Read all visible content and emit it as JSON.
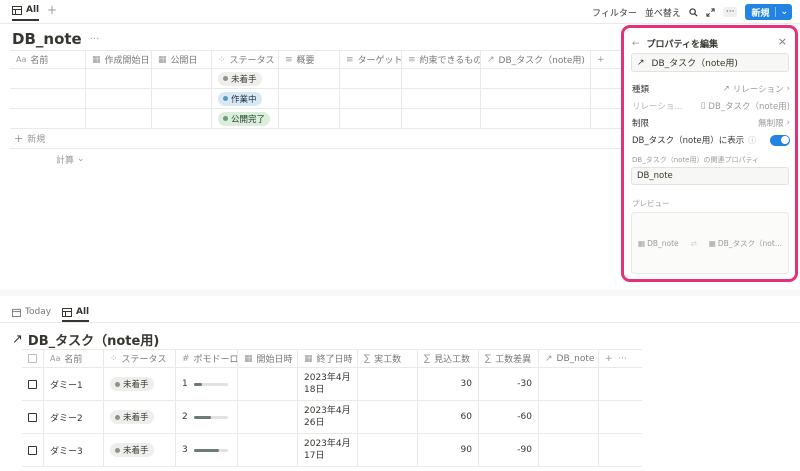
{
  "topbar": {
    "view_tab": "All",
    "filter": "フィルター",
    "sort": "並べ替え",
    "new_label": "新規"
  },
  "db1": {
    "title": "DB_note",
    "columns": [
      {
        "icon": "Aa",
        "label": "名前"
      },
      {
        "icon": "calendar-icon",
        "label": "作成開始日"
      },
      {
        "icon": "calendar-icon",
        "label": "公開日"
      },
      {
        "icon": "status-icon",
        "label": "ステータス"
      },
      {
        "icon": "text-icon",
        "label": "概要"
      },
      {
        "icon": "text-icon",
        "label": "ターゲット"
      },
      {
        "icon": "text-icon",
        "label": "約束できるもの"
      },
      {
        "icon": "relation-icon",
        "label": "DB_タスク（note用)"
      }
    ],
    "rows": [
      {
        "status": "未着手",
        "status_color": "gray"
      },
      {
        "status": "作業中",
        "status_color": "blue"
      },
      {
        "status": "公開完了",
        "status_color": "green"
      }
    ],
    "new_row": "新規",
    "calc": "計算"
  },
  "db2": {
    "tabs": [
      "Today",
      "All"
    ],
    "title": "DB_タスク（note用)",
    "columns": [
      {
        "icon": "Aa",
        "label": "名前"
      },
      {
        "icon": "status-icon",
        "label": "ステータス"
      },
      {
        "icon": "#",
        "label": "ポモドーロ"
      },
      {
        "icon": "calendar-icon",
        "label": "開始日時"
      },
      {
        "icon": "calendar-icon",
        "label": "終了日時"
      },
      {
        "icon": "sum-icon",
        "label": "実工数"
      },
      {
        "icon": "sum-icon",
        "label": "見込工数"
      },
      {
        "icon": "sum-icon",
        "label": "工数差異"
      },
      {
        "icon": "relation-icon",
        "label": "DB_note"
      }
    ],
    "rows": [
      {
        "name": "ダミー1",
        "status": "未着手",
        "pomodoro": "1",
        "pomo_fraction": 0.25,
        "end_line1": "2023年4月",
        "end_line2": "18日",
        "estimate": "30",
        "diff": "-30"
      },
      {
        "name": "ダミー2",
        "status": "未着手",
        "pomodoro": "2",
        "pomo_fraction": 0.5,
        "end_line1": "2023年4月",
        "end_line2": "26日",
        "estimate": "60",
        "diff": "-60"
      },
      {
        "name": "ダミー3",
        "status": "未着手",
        "pomodoro": "3",
        "pomo_fraction": 0.75,
        "end_line1": "2023年4月",
        "end_line2": "17日",
        "estimate": "90",
        "diff": "-90"
      }
    ]
  },
  "panel": {
    "title": "プロパティを編集",
    "prop_name": "DB_タスク（note用)",
    "type_label": "種類",
    "type_value": "リレーション",
    "relation_label": "リレーショ...",
    "relation_value": "DB_タスク（note用)",
    "limit_label": "制限",
    "limit_value": "無制限",
    "show_label": "DB_タスク（note用）に表示",
    "related_prop_label": "DB_タスク（note用）の関連プロパティ",
    "related_prop_value": "DB_note",
    "preview_label": "プレビュー",
    "preview_left": "DB_note",
    "preview_right": "DB_タスク（not..."
  }
}
